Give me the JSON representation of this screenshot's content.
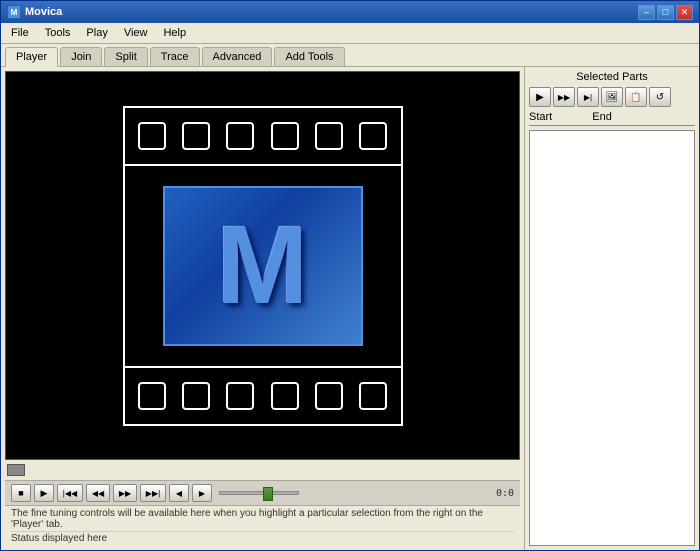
{
  "window": {
    "title": "Movica",
    "icon": "M",
    "minimize_label": "–",
    "restore_label": "□",
    "close_label": "✕"
  },
  "menu": {
    "items": [
      "File",
      "Tools",
      "Play",
      "View",
      "Help"
    ]
  },
  "tabs": {
    "items": [
      "Player",
      "Join",
      "Split",
      "Trace",
      "Advanced",
      "Add Tools"
    ],
    "active": "Player"
  },
  "right_panel": {
    "title": "Selected Parts",
    "toolbar": [
      "▶",
      "▶▶",
      "▶|",
      "🖼",
      "📋",
      "↺"
    ],
    "col_start": "Start",
    "col_end": "End"
  },
  "controls": {
    "stop": "■",
    "play": "▶",
    "prev_chapter": "|◀◀",
    "prev_frame": "◀◀",
    "next_frame": "▶▶",
    "next_chapter": "▶▶|",
    "vol_down": "◀",
    "vol_up": "▶",
    "time": "0:0"
  },
  "status": {
    "hint": "The fine tuning controls will be available here when you highlight a particular selection from the right on the 'Player' tab.",
    "status": "Status displayed here"
  },
  "logo": {
    "letter": "M"
  }
}
